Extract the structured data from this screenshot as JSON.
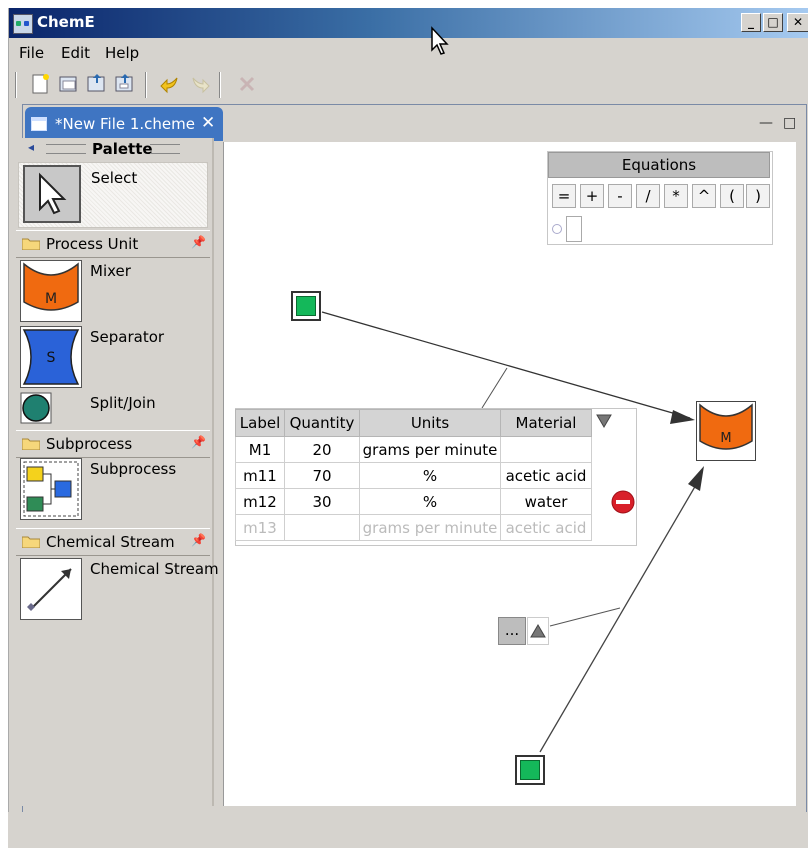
{
  "window": {
    "title": "ChemE",
    "minimize_label": "_",
    "maximize_label": "□",
    "close_label": "✕"
  },
  "menu": {
    "items": [
      {
        "label": "File"
      },
      {
        "label": "Edit"
      },
      {
        "label": "Help"
      }
    ]
  },
  "toolbar": {
    "icons": [
      "new-file-icon",
      "open-folder-icon",
      "save-icon",
      "save-as-icon",
      "undo-icon",
      "redo-icon",
      "delete-icon"
    ]
  },
  "editor": {
    "tab_label": "*New File 1.cheme",
    "tab_close": "✕",
    "frame_minimize": "—",
    "frame_maximize": "□"
  },
  "palette": {
    "title": "Palette",
    "select_label": "Select",
    "drawers": [
      {
        "label": "Process Unit",
        "entries": [
          {
            "label": "Mixer"
          },
          {
            "label": "Separator"
          },
          {
            "label": "Split/Join"
          }
        ]
      },
      {
        "label": "Subprocess",
        "entries": [
          {
            "label": "Subprocess"
          }
        ]
      },
      {
        "label": "Chemical Stream",
        "entries": [
          {
            "label": "Chemical Stream"
          }
        ]
      }
    ],
    "mixer_glyph": "M",
    "separator_glyph": "S"
  },
  "equations": {
    "title": "Equations",
    "buttons": [
      "=",
      "+",
      "-",
      "/",
      "*",
      "^",
      "(",
      ")"
    ]
  },
  "stream_table": {
    "columns": [
      "Label",
      "Quantity",
      "Units",
      "Material"
    ],
    "rows": [
      {
        "label": "M1",
        "quantity": "20",
        "units": "grams per minute",
        "material": ""
      },
      {
        "label": "m11",
        "quantity": "70",
        "units": "%",
        "material": "acetic acid"
      },
      {
        "label": "m12",
        "quantity": "30",
        "units": "%",
        "material": "water"
      },
      {
        "label": "m13",
        "quantity": "",
        "units": "grams per minute",
        "material": "acetic acid"
      }
    ]
  },
  "canvas": {
    "mixer_node_glyph": "M",
    "ellipsis_label": "..."
  },
  "colors": {
    "accent_blue": "#3f75c2",
    "mixer_orange": "#f06a10",
    "source_green": "#14b85a",
    "remove_red": "#d8202a"
  }
}
